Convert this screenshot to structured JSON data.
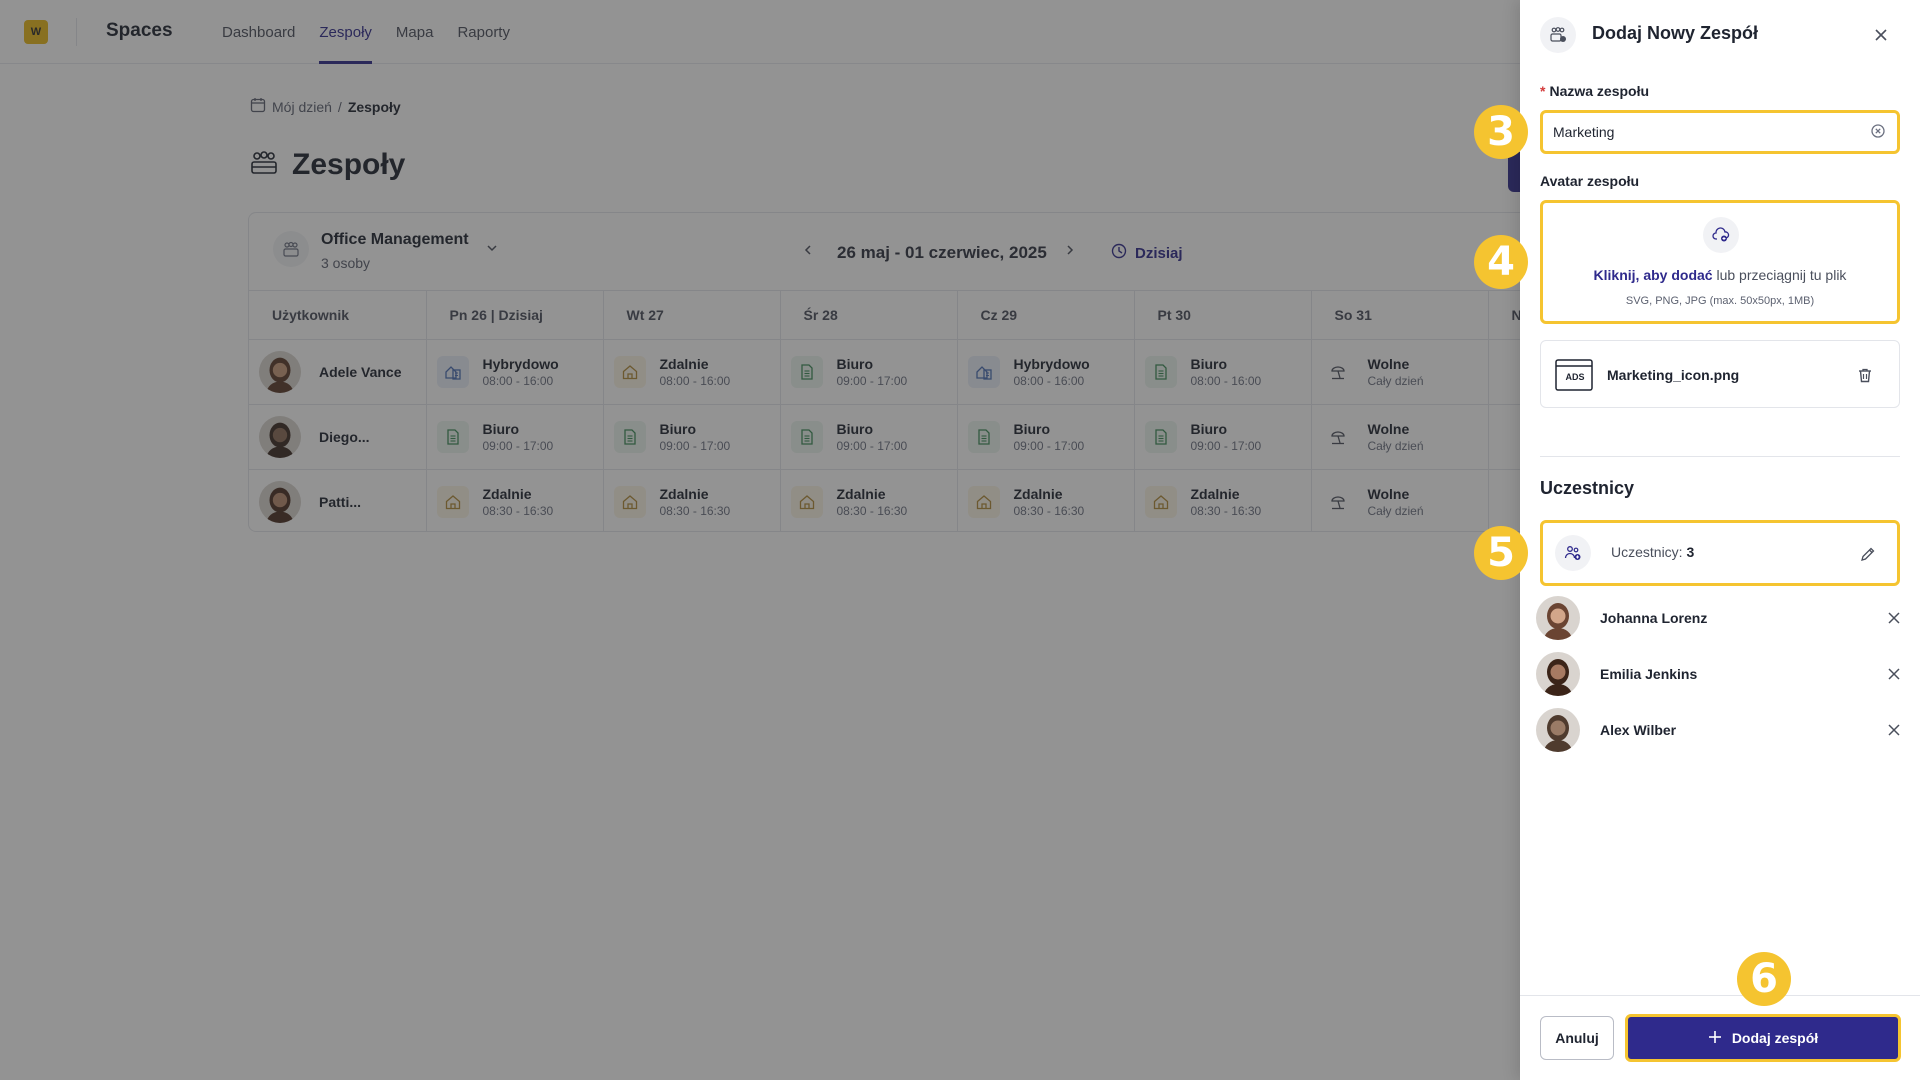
{
  "app": {
    "logo_text": "W",
    "name": "Spaces",
    "nav": [
      {
        "label": "Dashboard",
        "active": false
      },
      {
        "label": "Zespoły",
        "active": true
      },
      {
        "label": "Mapa",
        "active": false
      },
      {
        "label": "Raporty",
        "active": false
      }
    ]
  },
  "breadcrumb": {
    "parent": "Mój dzień",
    "separator": "/",
    "current": "Zespoły"
  },
  "page": {
    "title": "Zespoły"
  },
  "team_card": {
    "team_name": "Office Management",
    "team_count": "3 osoby",
    "week_range": "26 maj - 01 czerwiec, 2025",
    "today_label": "Dzisiaj",
    "columns": [
      "Użytkownik",
      "Pn 26 | Dzisiaj",
      "Wt 27",
      "Śr 28",
      "Cz 29",
      "Pt 30",
      "So 31",
      "N"
    ],
    "rows": [
      {
        "name": "Adele Vance",
        "days": [
          {
            "type": "Hybrydowo",
            "time": "08:00 - 16:00",
            "icon": "hybrid"
          },
          {
            "type": "Zdalnie",
            "time": "08:00 - 16:00",
            "icon": "home"
          },
          {
            "type": "Biuro",
            "time": "09:00 - 17:00",
            "icon": "office"
          },
          {
            "type": "Hybrydowo",
            "time": "08:00 - 16:00",
            "icon": "hybrid"
          },
          {
            "type": "Biuro",
            "time": "08:00 - 16:00",
            "icon": "office"
          },
          {
            "type": "Wolne",
            "time": "Cały dzień",
            "icon": "off"
          }
        ]
      },
      {
        "name": "Diego...",
        "days": [
          {
            "type": "Biuro",
            "time": "09:00 - 17:00",
            "icon": "office"
          },
          {
            "type": "Biuro",
            "time": "09:00 - 17:00",
            "icon": "office"
          },
          {
            "type": "Biuro",
            "time": "09:00 - 17:00",
            "icon": "office"
          },
          {
            "type": "Biuro",
            "time": "09:00 - 17:00",
            "icon": "office"
          },
          {
            "type": "Biuro",
            "time": "09:00 - 17:00",
            "icon": "office"
          },
          {
            "type": "Wolne",
            "time": "Cały dzień",
            "icon": "off"
          }
        ]
      },
      {
        "name": "Patti...",
        "days": [
          {
            "type": "Zdalnie",
            "time": "08:30 - 16:30",
            "icon": "home"
          },
          {
            "type": "Zdalnie",
            "time": "08:30 - 16:30",
            "icon": "home"
          },
          {
            "type": "Zdalnie",
            "time": "08:30 - 16:30",
            "icon": "home"
          },
          {
            "type": "Zdalnie",
            "time": "08:30 - 16:30",
            "icon": "home"
          },
          {
            "type": "Zdalnie",
            "time": "08:30 - 16:30",
            "icon": "home"
          },
          {
            "type": "Wolne",
            "time": "Cały dzień",
            "icon": "off"
          }
        ]
      }
    ]
  },
  "panel": {
    "title": "Dodaj Nowy Zespół",
    "name_label": "Nazwa zespołu",
    "name_required_mark": "*",
    "name_value": "Marketing",
    "avatar_label": "Avatar zespołu",
    "upload_link": "Kliknij, aby dodać",
    "upload_text": "lub przeciągnij tu plik",
    "upload_hint": "SVG, PNG, JPG (max. 50x50px, 1MB)",
    "file_thumb_text": "ADS",
    "file_name": "Marketing_icon.png",
    "participants_title": "Uczestnicy",
    "participants_label": "Uczestnicy:",
    "participants_count": "3",
    "members": [
      {
        "name": "Johanna Lorenz"
      },
      {
        "name": "Emilia Jenkins"
      },
      {
        "name": "Alex Wilber"
      }
    ],
    "cancel_label": "Anuluj",
    "submit_label": "Dodaj zespół"
  },
  "steps": [
    "3",
    "4",
    "5",
    "6"
  ],
  "colors": {
    "accent": "#2f2a8c",
    "highlight": "#f5c430",
    "overlay": "rgba(40,40,40,0.5)",
    "required": "#d33b3b"
  }
}
